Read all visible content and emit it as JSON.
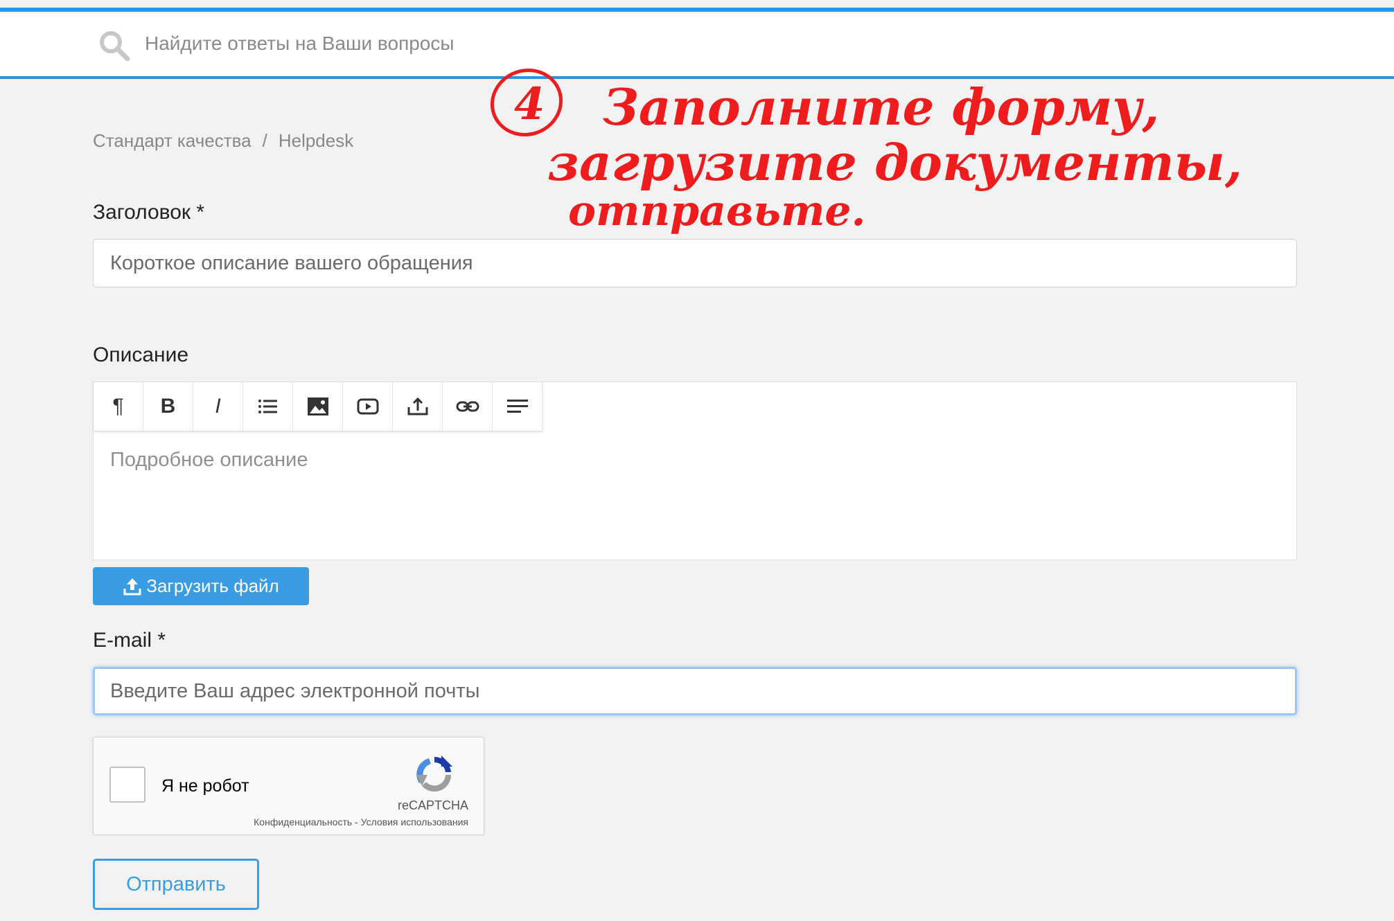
{
  "search": {
    "placeholder": "Найдите ответы на Ваши вопросы"
  },
  "breadcrumb": {
    "items": [
      "Стандарт качества",
      "Helpdesk"
    ],
    "separator": "/"
  },
  "form": {
    "title_label": "Заголовок *",
    "title_placeholder": "Короткое описание вашего обращения",
    "description_label": "Описание",
    "description_placeholder": "Подробное описание",
    "upload_label": "Загрузить файл",
    "email_label": "E-mail *",
    "email_placeholder": "Введите Ваш адрес электронной почты",
    "submit_label": "Отправить"
  },
  "toolbar": {
    "buttons": [
      "pilcrow-icon",
      "bold-icon",
      "italic-icon",
      "list-icon",
      "image-icon",
      "video-icon",
      "upload-icon",
      "link-icon",
      "align-icon"
    ],
    "bold_text": "B",
    "italic_text": "I",
    "pilcrow_text": "¶"
  },
  "captcha": {
    "label": "Я не робот",
    "brand": "reCAPTCHA",
    "terms": "Конфиденциальность - Условия использования"
  },
  "annotation": {
    "number": "4",
    "line1": "Заполните форму,",
    "line2": "загрузите документы,",
    "line3": "отправьте."
  },
  "colors": {
    "accent": "#2196f3",
    "button": "#3a9ce2",
    "annotation": "#ee1c1c"
  }
}
